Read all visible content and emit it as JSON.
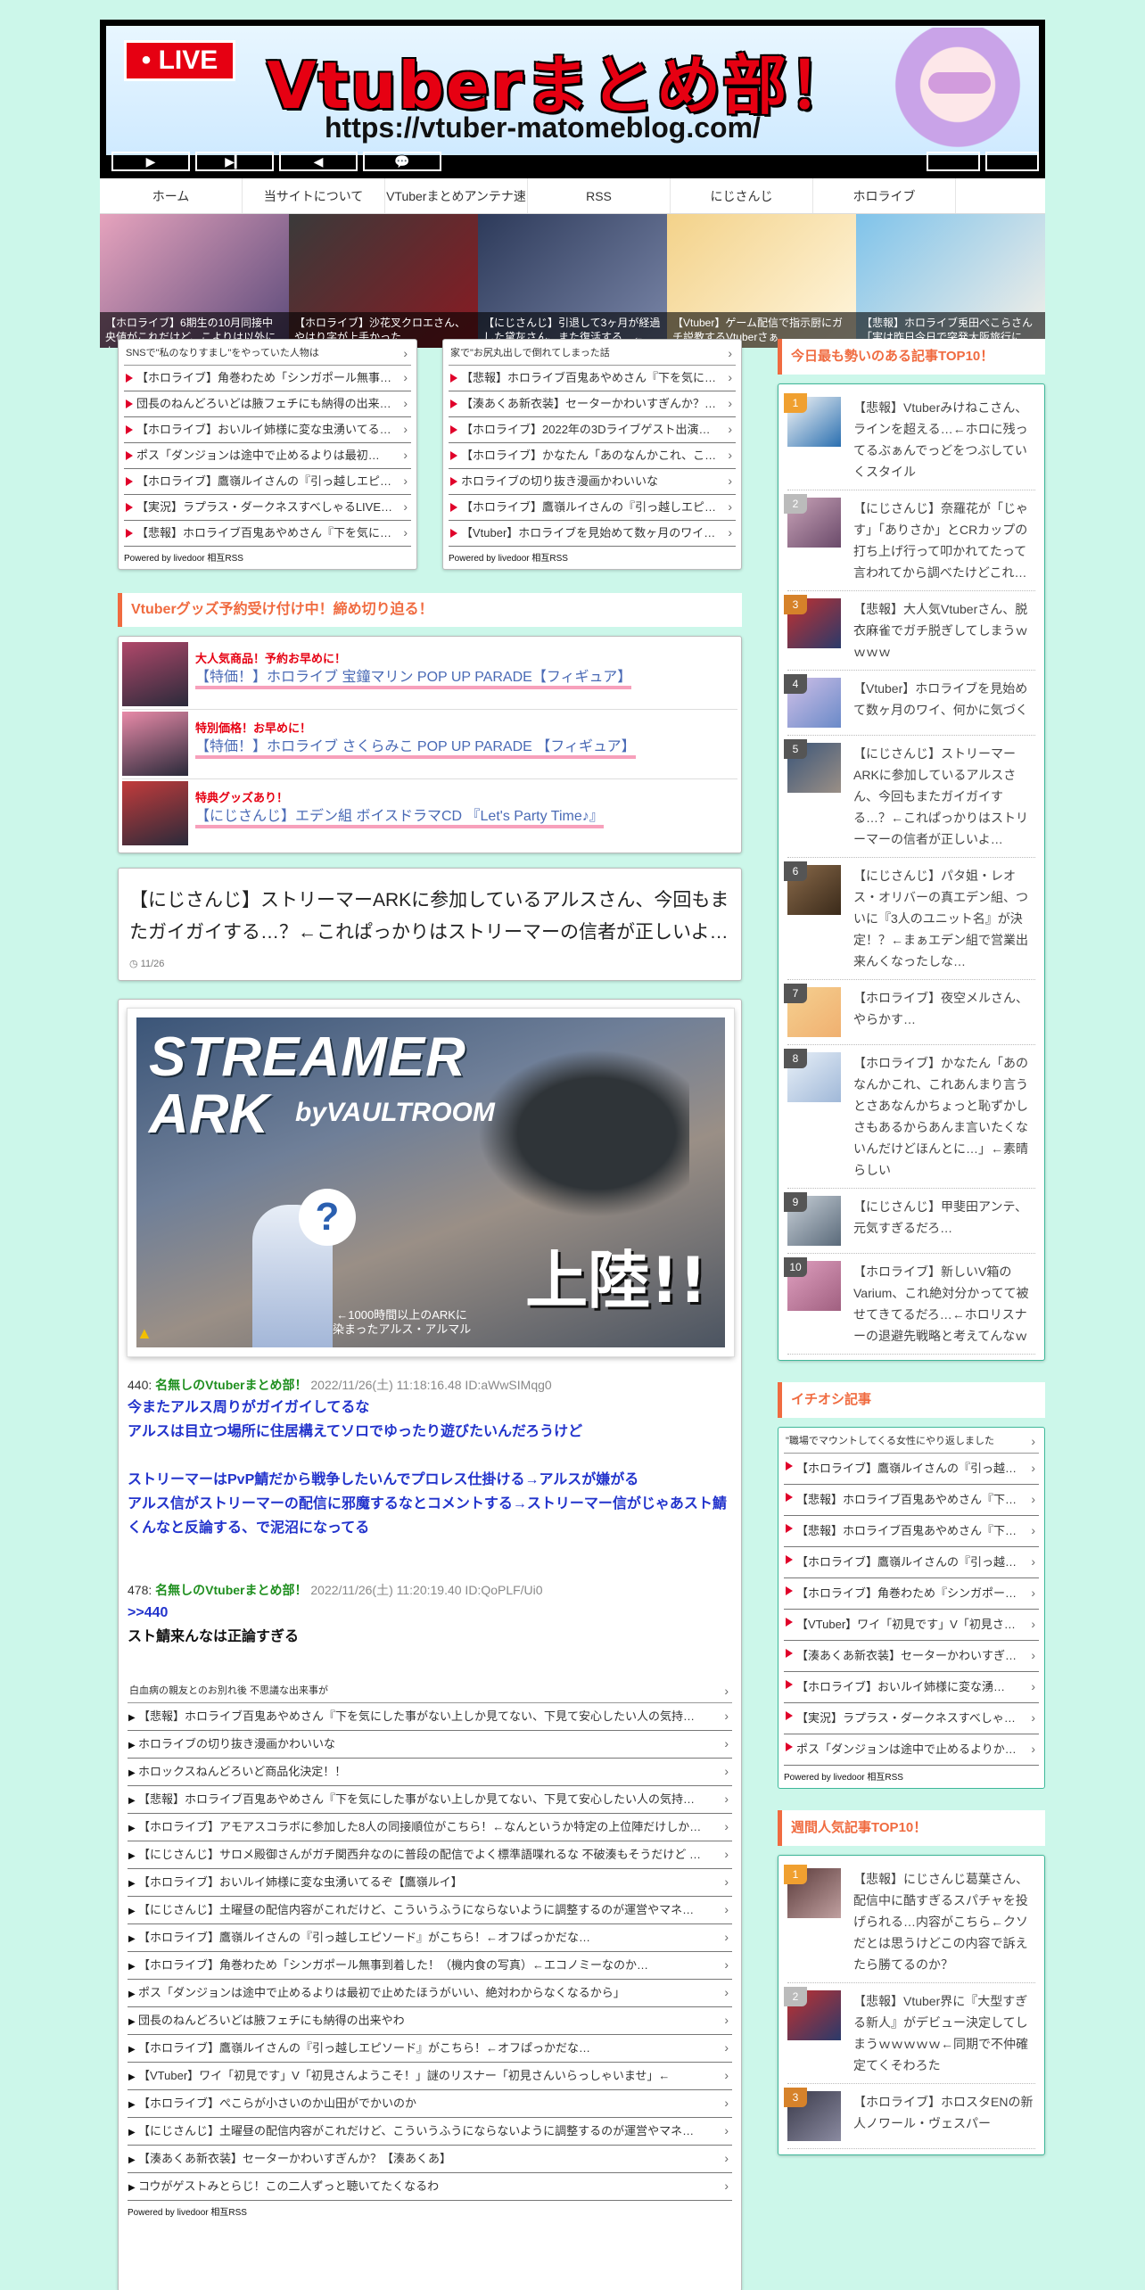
{
  "header": {
    "live_label": "• LIVE",
    "site_title": "Vtuberまとめ部！",
    "site_url": "https://vtuber-matomeblog.com/",
    "controls": [
      "▶",
      "▶▎",
      "◀",
      "💬"
    ]
  },
  "nav": [
    "ホーム",
    "当サイトについて",
    "VTuberまとめアンテナ速",
    "RSS",
    "にじさんじ",
    "ホロライブ"
  ],
  "slider": [
    {
      "caption": "【ホロライブ】6期生の10月同接中央値がこれだけど、こよりは以外にも…",
      "colors": [
        "#e6a3bd",
        "#5a4a7a"
      ]
    },
    {
      "caption": "【ホロライブ】沙花叉クロエさん、やはり字が上手かった…",
      "colors": [
        "#3a3a3a",
        "#8a1a22"
      ]
    },
    {
      "caption": "【にじさんじ】引退して3ヶ月が経過した黛灰さん、また復活する…←",
      "colors": [
        "#2d3a5a",
        "#7a86a8"
      ]
    },
    {
      "caption": "【Vtuber】ゲーム配信で指示厨にガチ説教するVtuberさぁ…",
      "colors": [
        "#f3d28a",
        "#fff6de"
      ]
    },
    {
      "caption": "【悲報】ホロライブ兎田ぺこらさん「実は昨日今日で突発大阪旅行に行…",
      "colors": [
        "#7fc3ea",
        "#f5f0e8"
      ]
    }
  ],
  "rss_left": {
    "heading": "SNSで\"私のなりすまし\"をやっていた人物は",
    "items": [
      "【ホロライブ】角巻わため「シンガポール無事着いた！…",
      "団長のねんどろいどは腋フェチにも納得の出来…",
      "【ホロライブ】おいルイ姉様に変な虫湧いてる…",
      "ポス「ダンジョンは途中で止めるよりは最初…",
      "【ホロライブ】鷹嶺ルイさんの『引っ越しエピ…",
      "【実況】ラプラス・ダークネスすべしゃるLIVE…",
      "【悲報】ホロライブ百鬼あやめさん『下を気に…"
    ],
    "footer": "Powered by livedoor 相互RSS"
  },
  "rss_right": {
    "heading": "家で\"お尻丸出しで倒れてしまった話",
    "items": [
      "【悲報】ホロライブ百鬼あやめさん『下を気に…",
      "【湊あくあ新衣装】セーターかわいすぎんか？…",
      "【ホロライブ】2022年の3Dライブゲスト出演回…",
      "【ホロライブ】かなたん「あのなんかこれ、こ…",
      "ホロライブの切り抜き漫画かわいいな",
      "【ホロライブ】鷹嶺ルイさんの『引っ越しエピ…",
      "【Vtuber】ホロライブを見始めて数ヶ月のワイ…"
    ],
    "footer": "Powered by livedoor 相互RSS"
  },
  "goods": {
    "title": "Vtuberグッズ予約受け付け中！締め切り迫る！",
    "items": [
      {
        "badge": "大人気商品！予約お早めに！",
        "link": "【特価！】ホロライブ 宝鐘マリン POP UP PARADE【フィギュア】",
        "color": "#b0486a"
      },
      {
        "badge": "特別価格！お早めに！",
        "link": "【特価！】ホロライブ さくらみこ POP UP PARADE 【フィギュア】",
        "color": "#e88aa8"
      },
      {
        "badge": "特典グッズあり！",
        "link": "【にじさんじ】エデン組 ボイスドラマCD 『Let's Party Time♪』",
        "color": "#c23b3b"
      }
    ]
  },
  "article": {
    "title": "【にじさんじ】ストリーマーARKに参加しているアルスさん、今回もまたガイガイする…？←これぱっかりはストリーマーの信者が正しいよ…",
    "date": "11/26"
  },
  "hero": {
    "line1": "STREAMER",
    "line2": "ARK",
    "by": "byVAULTROOM",
    "landing": "上陸!!",
    "note": "←1000時間以上のARKに\n染まったアルス・アルマル"
  },
  "comments": [
    {
      "num": "440:",
      "name": "名無しのVtuberまとめ部！",
      "meta": "2022/11/26(土) 11:18:16.48 ID:aWwSIMqg0",
      "lines": [
        {
          "text": "今またアルス周りがガイガイしてるな",
          "color": "blue"
        },
        {
          "text": "アルスは目立つ場所に住居構えてソロでゆったり遊びたいんだろうけど",
          "color": "blue"
        },
        {
          "text": "",
          "color": "gap"
        },
        {
          "text": "ストリーマーはPvP鯖だから戦争したいんでプロレス仕掛ける→アルスが嫌がる",
          "color": "blue"
        },
        {
          "text": "アルス信がストリーマーの配信に邪魔するなとコメントする→ストリーマー信がじゃあスト鯖くんなと反論する、で泥沼になってる",
          "color": "blue"
        }
      ]
    },
    {
      "num": "478:",
      "name": "名無しのVtuberまとめ部！",
      "meta": "2022/11/26(土) 11:20:19.40 ID:QoPLF/Ui0",
      "lines": [
        {
          "text": ">>440",
          "color": "blue"
        },
        {
          "text": "スト鯖来んなは正論すぎる",
          "color": "black"
        }
      ]
    }
  ],
  "rss_bottom": {
    "heading": "白血病の親友とのお別れ後 不思議な出来事が",
    "items": [
      "【悲報】ホロライブ百鬼あやめさん『下を気にした事がない上しか見てない、下見て安心したい人の気持…",
      "ホロライブの切り抜き漫画かわいいな",
      "ホロックスねんどろいど商品化決定！！",
      "【悲報】ホロライブ百鬼あやめさん『下を気にした事がない上しか見てない、下見て安心したい人の気持…",
      "【ホロライブ】アモアスコラボに参加した8人の同接順位がこちら！←なんというか特定の上位陣だけしか…",
      "【にじさんじ】サロメ殿御さんがガチ関西弁なのに普段の配信でよく標準語喋れるな 不破湊もそうだけど …",
      "【ホロライブ】おいルイ姉様に変な虫湧いてるぞ【鷹嶺ルイ】",
      "【にじさんじ】土曜昼の配信内容がこれだけど、こういうふうにならないように調整するのが運営やマネ…",
      "【ホロライブ】鷹嶺ルイさんの『引っ越しエピソード』がこちら！←オフぱっかだな…",
      "【ホロライブ】角巻わため「シンガポール無事到着した！（機内食の写真）←エコノミーなのか…",
      "ポス「ダンジョンは途中で止めるよりは最初で止めたほうがいい、絶対わからなくなるから」",
      "団長のねんどろいどは腋フェチにも納得の出来やわ",
      "【ホロライブ】鷹嶺ルイさんの『引っ越しエピソード』がこちら！←オフぱっかだな…",
      "【VTuber】ワイ「初見です」V「初見さんようこそ！」謎のリスナー「初見さんいらっしゃいませ」←",
      "【ホロライブ】ぺこらが小さいのか山田がでかいのか",
      "【にじさんじ】土曜昼の配信内容がこれだけど、こういうふうにならないように調整するのが運営やマネ…",
      "【湊あくあ新衣装】セーターかわいすぎんか？【湊あくあ】",
      "コウがゲストみとらじ！この二人ずっと聴いてたくなるわ"
    ],
    "footer": "Powered by livedoor 相互RSS"
  },
  "side_rank": {
    "title": "今日最も勢いのある記事TOP10！",
    "items": [
      {
        "num": "1",
        "text": "【悲報】Vtuberみけねこさん、ラインを超える…←ホロに残ってるぶぁんでっどをつぶしていくスタイル",
        "badge": "#f0a030",
        "thumb": [
          "#f8f8f8",
          "#2a6fb0"
        ]
      },
      {
        "num": "2",
        "text": "【にじさんじ】奈羅花が「じゃす」「ありさか」とCRカップの打ち上げ行って叩かれてたって言われてから調べたけどこれ…",
        "badge": "#bbbbbb",
        "thumb": [
          "#c9a3b8",
          "#6a4a6a"
        ]
      },
      {
        "num": "3",
        "text": "【悲報】大人気Vtuberさん、脱衣麻雀でガチ脱ぎしてしまうｗｗｗｗ",
        "badge": "#d6822a",
        "thumb": [
          "#c23030",
          "#2a3a6a"
        ]
      },
      {
        "num": "4",
        "text": "【Vtuber】ホロライブを見始めて数ヶ月のワイ、何かに気づく",
        "badge": "#555555",
        "thumb": [
          "#d0c0e8",
          "#6a8ac8"
        ]
      },
      {
        "num": "5",
        "text": "【にじさんじ】ストリーマーARKに参加しているアルスさん、今回もまたガイガイする…？←これぱっかりはストリーマーの信者が正しいよ…",
        "badge": "#555555",
        "thumb": [
          "#3b5578",
          "#9a8f86"
        ]
      },
      {
        "num": "6",
        "text": "【にじさんじ】パタ姐・レオス・オリバーの真エデン組、ついに『3人のユニット名』が決定！？←まぁエデン組で営業出来んくなったしな…",
        "badge": "#555555",
        "thumb": [
          "#8a6a4a",
          "#3a2a1a"
        ]
      },
      {
        "num": "7",
        "text": "【ホロライブ】夜空メルさん、やらかす…",
        "badge": "#555555",
        "thumb": [
          "#f5d090",
          "#f0b070"
        ]
      },
      {
        "num": "8",
        "text": "【ホロライブ】かなたん「あのなんかこれ、これあんまり言うとさあなんかちょっと恥ずかしさもあるからあんま言いたくないんだけどほんとに…」←素晴らしい",
        "badge": "#555555",
        "thumb": [
          "#e8f0f8",
          "#a0b8d8"
        ]
      },
      {
        "num": "9",
        "text": "【にじさんじ】甲斐田アンテ、元気すぎるだろ…",
        "badge": "#555555",
        "thumb": [
          "#c8d0d8",
          "#5a6a7a"
        ]
      },
      {
        "num": "10",
        "text": "【ホロライブ】新しいV箱のVarium、これ絶対分かってて被せてきてるだろ…←ホロリスナーの退避先戦略と考えてんなｗ",
        "badge": "#555555",
        "thumb": [
          "#e0a0c0",
          "#a06080"
        ]
      }
    ]
  },
  "side_pick": {
    "title": "イチオシ記事",
    "heading": "\"職場でマウントしてくる女性にやり返しました",
    "items": [
      "【ホロライブ】鷹嶺ルイさんの『引っ越…",
      "【悲報】ホロライブ百鬼あやめさん『下…",
      "【悲報】ホロライブ百鬼あやめさん『下…",
      "【ホロライブ】鷹嶺ルイさんの『引っ越…",
      "【ホロライブ】角巻わため『シンガポー…",
      "【VTuber】ワイ「初見です」V「初見さ…",
      "【湊あくあ新衣装】セーターかわいすぎ…",
      "【ホロライブ】おいルイ姉様に変な湧…",
      "【実況】ラプラス・ダークネスすべしゃ…",
      "ポス「ダンジョンは途中で止めるよりか…"
    ],
    "footer": "Powered by livedoor 相互RSS"
  },
  "side_week": {
    "title": "週間人気記事TOP10！",
    "items": [
      {
        "num": "1",
        "text": "【悲報】にじさんじ葛葉さん、配信中に酷すぎるスパチャを投げられる…内容がこちら←クソだとは思うけどこの内容で訴えたら勝てるのか？",
        "badge": "#f0a030",
        "thumb": [
          "#5a3a3a",
          "#c0a0a0"
        ]
      },
      {
        "num": "2",
        "text": "【悲報】Vtuber界に『大型すぎる新人』がデビュー決定してしまうｗｗｗｗｗ←同期で不仲確定てくそわろた",
        "badge": "#bbbbbb",
        "thumb": [
          "#c23030",
          "#2a3a6a"
        ]
      },
      {
        "num": "3",
        "text": "【ホロライブ】ホロスタENの新人ノワール・ヴェスパー",
        "badge": "#d6822a",
        "thumb": [
          "#3a3a4a",
          "#8a8aa0"
        ]
      }
    ]
  }
}
